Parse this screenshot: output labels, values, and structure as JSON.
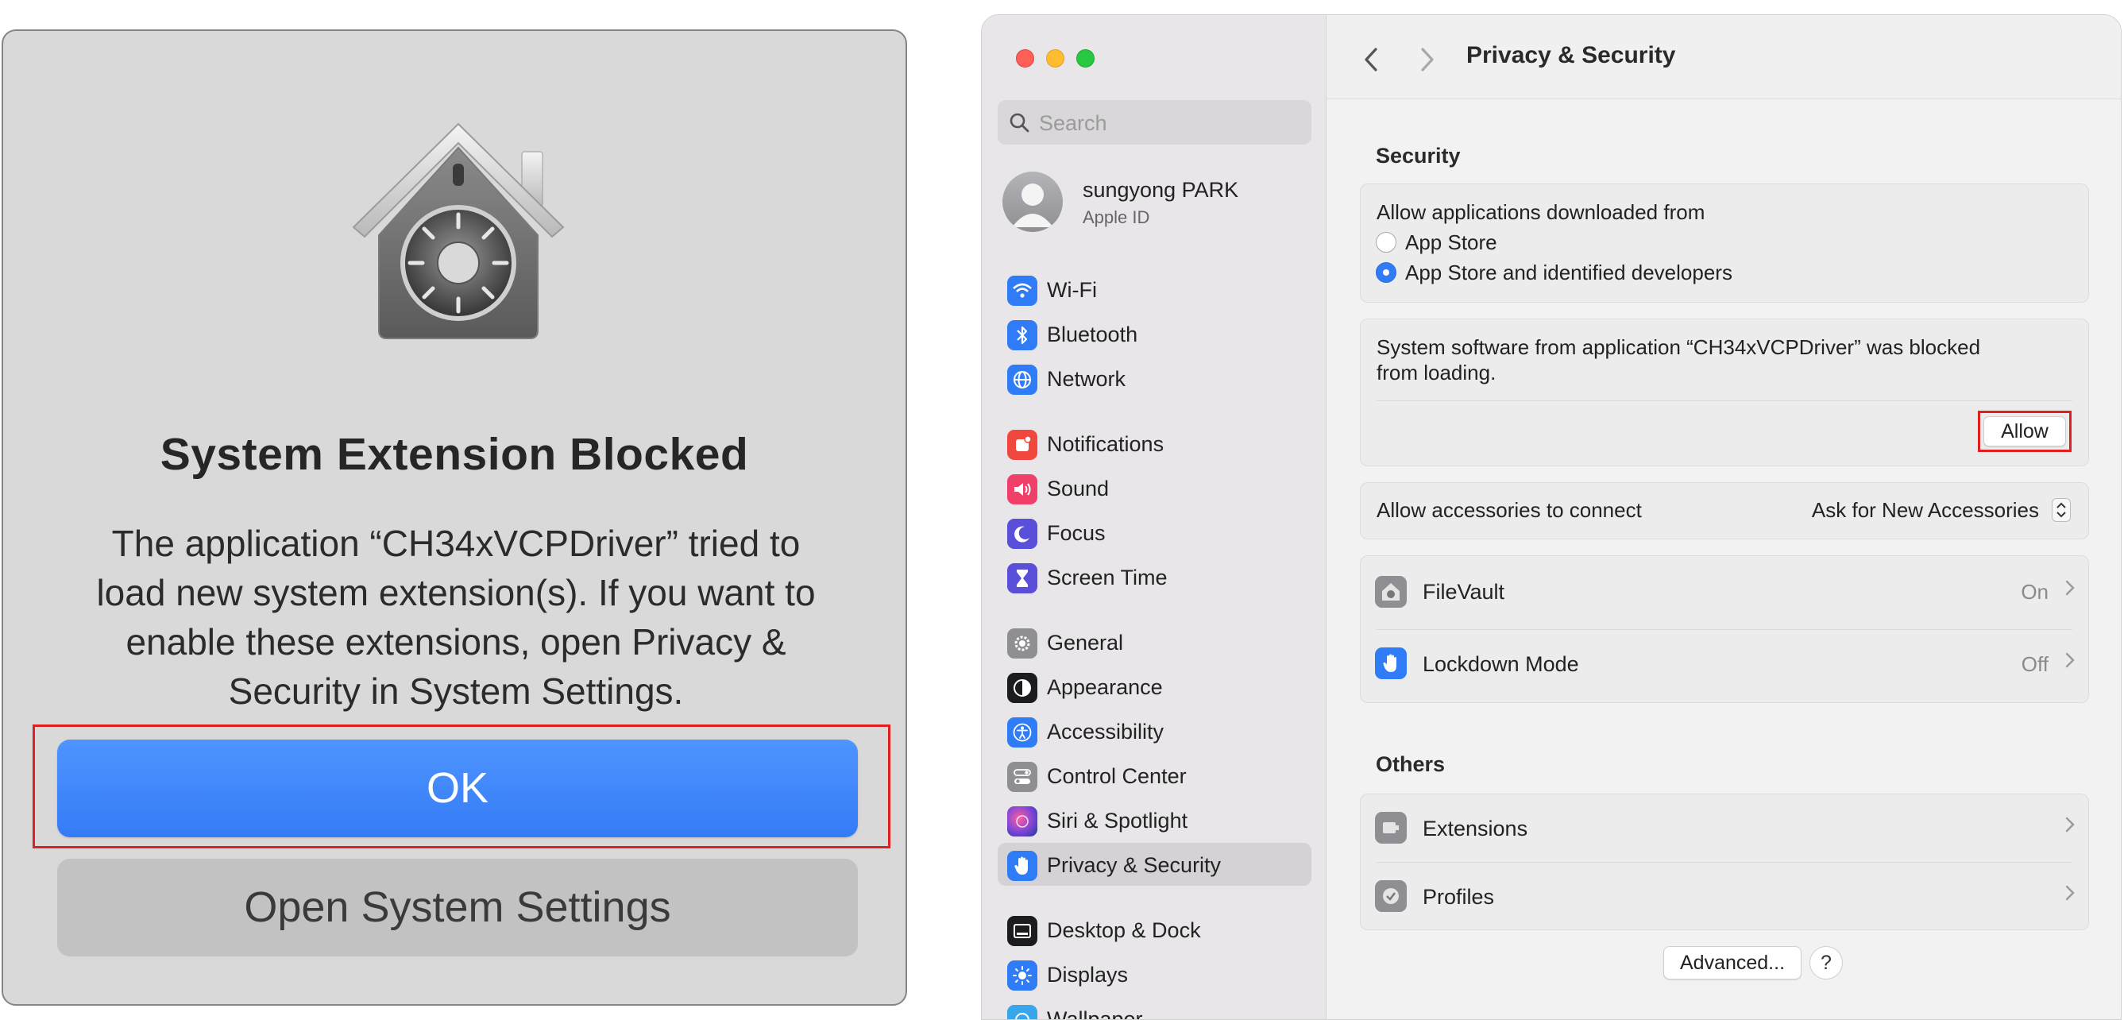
{
  "alert": {
    "title": "System Extension Blocked",
    "message": "The application “CH34xVCPDriver” tried to load new system extension(s). If you want to enable these extensions, open Privacy & Security in System Settings.",
    "ok_label": "OK",
    "open_settings_label": "Open System Settings",
    "ok_color": "#3a81f7"
  },
  "settings": {
    "search": {
      "placeholder": "Search"
    },
    "account": {
      "name": "sungyong PARK",
      "subtitle": "Apple ID"
    },
    "sidebar_items": [
      {
        "label": "Wi-Fi",
        "icon": "wifi-icon",
        "color": "#2f7cf6"
      },
      {
        "label": "Bluetooth",
        "icon": "bluetooth-icon",
        "color": "#2f7cf6"
      },
      {
        "label": "Network",
        "icon": "globe-icon",
        "color": "#2f7cf6"
      },
      {
        "label": "Notifications",
        "icon": "bell-icon",
        "color": "#f0473f"
      },
      {
        "label": "Sound",
        "icon": "speaker-icon",
        "color": "#f0406a"
      },
      {
        "label": "Focus",
        "icon": "moon-icon",
        "color": "#5a4fd8"
      },
      {
        "label": "Screen Time",
        "icon": "hourglass-icon",
        "color": "#5a4fd8"
      },
      {
        "label": "General",
        "icon": "gear-icon",
        "color": "#8e8e93"
      },
      {
        "label": "Appearance",
        "icon": "appearance-icon",
        "color": "#1c1c1e"
      },
      {
        "label": "Accessibility",
        "icon": "accessibility-icon",
        "color": "#2f7cf6"
      },
      {
        "label": "Control Center",
        "icon": "toggles-icon",
        "color": "#8e8e93"
      },
      {
        "label": "Siri & Spotlight",
        "icon": "siri-icon",
        "color": "#7a45d8"
      },
      {
        "label": "Privacy & Security",
        "icon": "hand-icon",
        "color": "#2f7cf6",
        "selected": true
      },
      {
        "label": "Desktop & Dock",
        "icon": "dock-icon",
        "color": "#1c1c1e"
      },
      {
        "label": "Displays",
        "icon": "sun-icon",
        "color": "#2f7cf6"
      },
      {
        "label": "Wallpaper",
        "icon": "wallpaper-icon",
        "color": "#38a6ea"
      }
    ],
    "pane_title": "Privacy & Security",
    "security": {
      "section_title": "Security",
      "downloads_label": "Allow applications downloaded from",
      "options": [
        {
          "label": "App Store",
          "selected": false
        },
        {
          "label": "App Store and identified developers",
          "selected": true
        }
      ],
      "blocked_message_line1": "System software from application “CH34xVCPDriver” was blocked",
      "blocked_message_line2": "from loading.",
      "allow_label": "Allow",
      "accessories_label": "Allow accessories to connect",
      "accessories_value": "Ask for New Accessories",
      "filevault_label": "FileVault",
      "filevault_value": "On",
      "lockdown_label": "Lockdown Mode",
      "lockdown_value": "Off"
    },
    "others": {
      "section_title": "Others",
      "extensions_label": "Extensions",
      "profiles_label": "Profiles"
    },
    "advanced_label": "Advanced...",
    "help_label": "?"
  }
}
